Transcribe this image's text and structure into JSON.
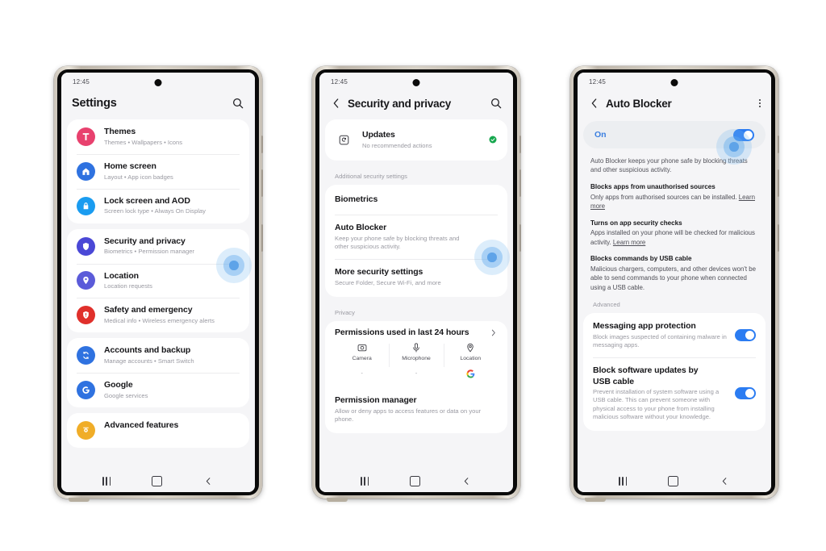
{
  "meta": {
    "status_time": "12:45",
    "accent": "#2b7cf2",
    "tap_accent": "#5ea3e8"
  },
  "phone1": {
    "title": "Settings",
    "search_icon": "search-icon",
    "groups": [
      {
        "rows": [
          {
            "icon": "themes-icon",
            "color": "#e8416e",
            "title": "Themes",
            "subtitle": "Themes • Wallpapers • Icons"
          },
          {
            "icon": "home-screen-icon",
            "color": "#2f72e0",
            "title": "Home screen",
            "subtitle": "Layout • App icon badges"
          },
          {
            "icon": "lock-icon",
            "color": "#1a9cf0",
            "title": "Lock screen and AOD",
            "subtitle": "Screen lock type • Always On Display"
          }
        ]
      },
      {
        "rows": [
          {
            "icon": "shield-icon",
            "color": "#4a48d6",
            "title": "Security and privacy",
            "subtitle": "Biometrics • Permission manager"
          },
          {
            "icon": "location-pin-icon",
            "color": "#5b5bd9",
            "title": "Location",
            "subtitle": "Location requests"
          },
          {
            "icon": "safety-icon",
            "color": "#e0302b",
            "title": "Safety and emergency",
            "subtitle": "Medical info • Wireless emergency alerts"
          }
        ]
      },
      {
        "rows": [
          {
            "icon": "sync-icon",
            "color": "#2f72e0",
            "title": "Accounts and backup",
            "subtitle": "Manage accounts • Smart Switch"
          },
          {
            "icon": "google-g-icon",
            "color": "#2f72e0",
            "title": "Google",
            "subtitle": "Google services"
          }
        ]
      },
      {
        "rows": [
          {
            "icon": "advanced-features-icon",
            "color": "#f0ad28",
            "title": "Advanced features",
            "subtitle": ""
          }
        ]
      }
    ]
  },
  "phone2": {
    "title": "Security and privacy",
    "back_icon": "chevron-left-icon",
    "search_icon": "search-icon",
    "updates": {
      "icon": "updates-icon",
      "title": "Updates",
      "subtitle": "No recommended actions",
      "status_icon": "check-circle-icon",
      "status_color": "#16a74e"
    },
    "section_additional": "Additional security settings",
    "additional_rows": [
      {
        "title": "Biometrics",
        "subtitle": ""
      },
      {
        "title": "Auto Blocker",
        "subtitle": "Keep your phone safe by blocking threats and other suspicious activity."
      },
      {
        "title": "More security settings",
        "subtitle": "Secure Folder, Secure Wi-Fi, and more"
      }
    ],
    "section_privacy": "Privacy",
    "permissions_title": "Permissions used in last 24 hours",
    "permissions_chevron": "chevron-right-icon",
    "permission_tiles": [
      {
        "icon": "camera-icon",
        "label": "Camera",
        "value": "-"
      },
      {
        "icon": "microphone-icon",
        "label": "Microphone",
        "value": "-"
      },
      {
        "icon": "location-icon",
        "label": "Location",
        "value": "google-g-icon"
      }
    ],
    "permission_manager": {
      "title": "Permission manager",
      "subtitle": "Allow or deny apps to access features or data on your phone."
    }
  },
  "phone3": {
    "title": "Auto Blocker",
    "back_icon": "chevron-left-icon",
    "menu_icon": "kebab-menu-icon",
    "toggle_label": "On",
    "toggle_state": "on",
    "lead": "Auto Blocker keeps your phone safe by blocking threats and other suspicious activity.",
    "paragraphs": [
      {
        "heading": "Blocks apps from unauthorised sources",
        "body": "Only apps from authorised sources can be installed. ",
        "link": "Learn more"
      },
      {
        "heading": "Turns on app security checks",
        "body": "Apps installed on your phone will be checked for malicious activity. ",
        "link": "Learn more"
      },
      {
        "heading": "Blocks commands by USB cable",
        "body": "Malicious chargers, computers, and other devices won't be able to send commands to your phone when connected using a USB cable.",
        "link": ""
      }
    ],
    "section_advanced": "Advanced",
    "advanced_rows": [
      {
        "title": "Messaging app protection",
        "subtitle": "Block images suspected of containing malware in messaging apps.",
        "toggle": "on"
      },
      {
        "title": "Block software updates by USB cable",
        "subtitle": "Prevent installation of system software using a USB cable. This can prevent someone with physical access to your phone from installing malicious software without your knowledge.",
        "toggle": "on"
      }
    ]
  },
  "navbar": {
    "recents_icon": "recents-icon",
    "home_icon": "home-icon",
    "back_icon": "back-icon"
  }
}
